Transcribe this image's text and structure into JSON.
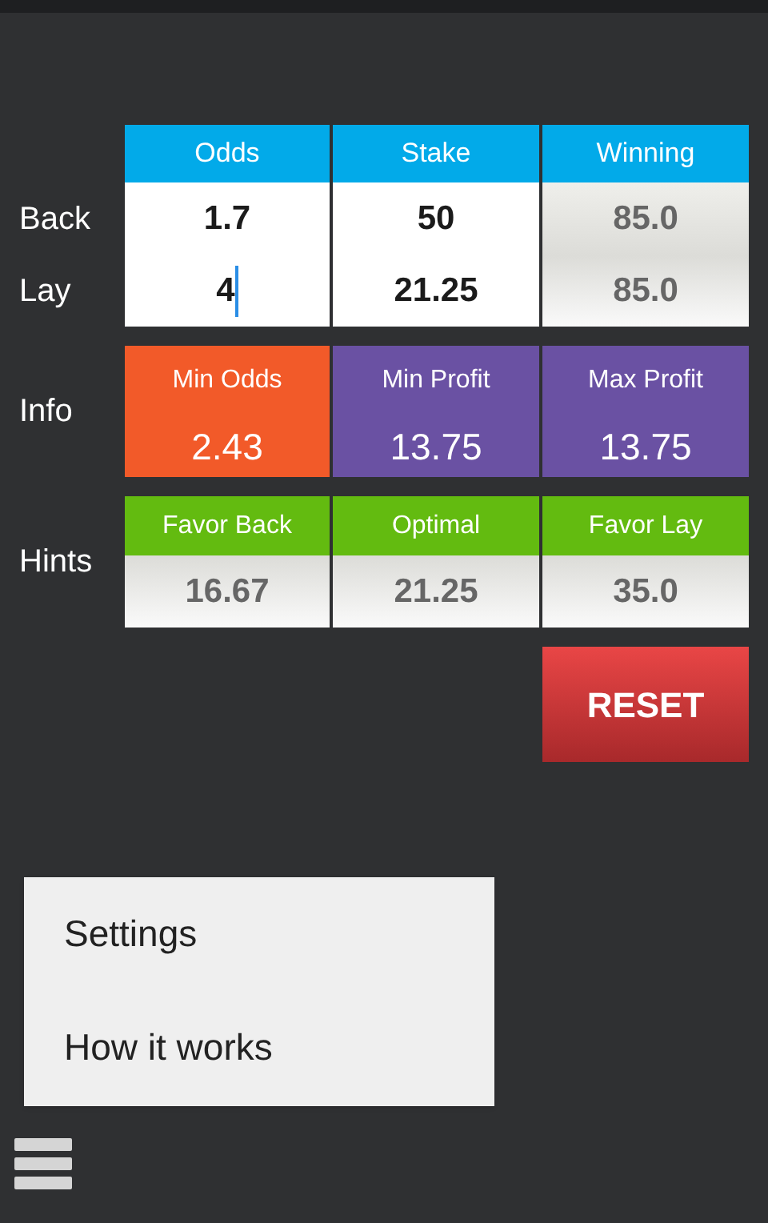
{
  "table": {
    "columns": [
      "Odds",
      "Stake",
      "Winning"
    ],
    "rows": [
      {
        "label": "Back",
        "cells": [
          {
            "kind": "input",
            "value": "1.7",
            "focused": false
          },
          {
            "kind": "input",
            "value": "50",
            "focused": false
          },
          {
            "kind": "output",
            "value": "85.0"
          }
        ]
      },
      {
        "label": "Lay",
        "cells": [
          {
            "kind": "input",
            "value": "4",
            "focused": true
          },
          {
            "kind": "input",
            "value": "21.25",
            "focused": false
          },
          {
            "kind": "output",
            "value": "85.0"
          }
        ]
      }
    ]
  },
  "info": {
    "label": "Info",
    "items": [
      {
        "title": "Min Odds",
        "value": "2.43",
        "color": "#f25a29"
      },
      {
        "title": "Min Profit",
        "value": "13.75",
        "color": "#6a51a3"
      },
      {
        "title": "Max Profit",
        "value": "13.75",
        "color": "#6a51a3"
      }
    ]
  },
  "hints": {
    "label": "Hints",
    "items": [
      {
        "title": "Favor Back",
        "value": "16.67"
      },
      {
        "title": "Optimal",
        "value": "21.25"
      },
      {
        "title": "Favor Lay",
        "value": "35.0"
      }
    ]
  },
  "reset_button": "RESET",
  "menu": [
    "Settings",
    "How it works"
  ]
}
